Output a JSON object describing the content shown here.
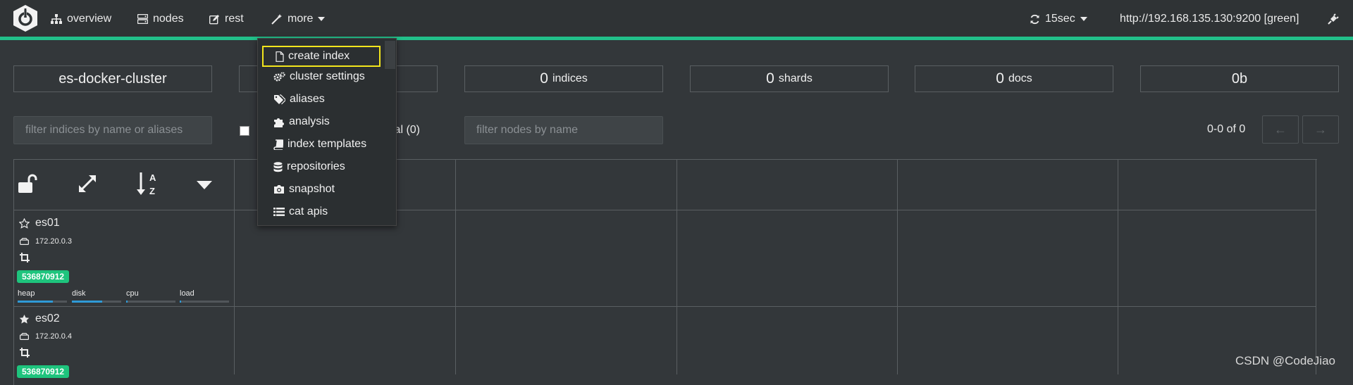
{
  "nav": {
    "overview": "overview",
    "nodes": "nodes",
    "rest": "rest",
    "more": "more",
    "refresh": "15sec",
    "cluster_url": "http://192.168.135.130:9200 [green]"
  },
  "stats": {
    "cluster_name": "es-docker-cluster",
    "indices_count": "0",
    "indices_label": "indices",
    "shards_count": "0",
    "shards_label": "shards",
    "docs_count": "0",
    "docs_label": "docs",
    "size": "0b"
  },
  "filters": {
    "indices_placeholder": "filter indices by name or aliases",
    "special_suffix": "ial (0)",
    "nodes_placeholder": "filter nodes by name",
    "pagination": "0-0 of 0",
    "prev": "←",
    "next": "→"
  },
  "menu": {
    "items": [
      "create index",
      "cluster settings",
      "aliases",
      "analysis",
      "index templates",
      "repositories",
      "snapshot",
      "cat apis"
    ]
  },
  "nodes": [
    {
      "name": "es01",
      "ip": "172.20.0.3",
      "badge": "536870912",
      "master": false
    },
    {
      "name": "es02",
      "ip": "172.20.0.4",
      "badge": "536870912",
      "master": true
    }
  ],
  "meters": {
    "labels": [
      "heap",
      "disk",
      "cpu",
      "load"
    ],
    "heap_fraction": 0.72,
    "disk_fraction": 0.62,
    "cpu_fraction": 0.03,
    "load_fraction": 0.03
  },
  "watermark": "CSDN @CodeJiao",
  "colors": {
    "accent": "#22c08a",
    "badge": "#1ec47d",
    "highlight": "#f2e51c",
    "meter": "#2f9ad6"
  }
}
